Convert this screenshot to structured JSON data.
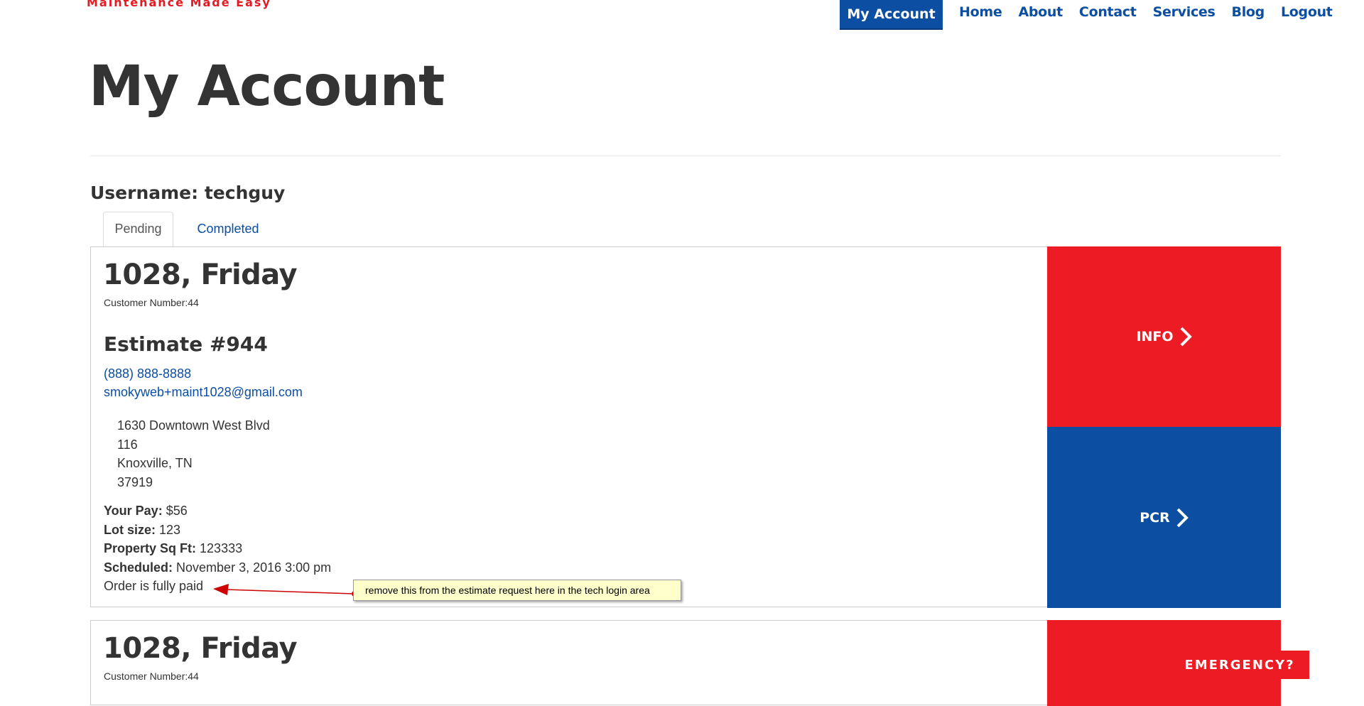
{
  "header": {
    "tagline": "Maintenance Made Easy",
    "nav": {
      "active": "My Account",
      "links": [
        "Home",
        "About",
        "Contact",
        "Services",
        "Blog",
        "Logout"
      ]
    }
  },
  "page": {
    "title": "My Account",
    "username": "Username: techguy"
  },
  "tabs": [
    "Pending",
    "Completed"
  ],
  "orders": [
    {
      "title": "1028, Friday",
      "customer_number": "Customer Number:44",
      "estimate": "Estimate #944",
      "phone": "(888) 888-8888",
      "email": "smokyweb+maint1028@gmail.com",
      "address": [
        "1630 Downtown West Blvd",
        "116",
        "Knoxville, TN",
        "37919"
      ],
      "details": [
        {
          "label": "Your Pay:",
          "value": "$56"
        },
        {
          "label": "Lot size:",
          "value": "123"
        },
        {
          "label": "Property Sq Ft:",
          "value": "123333"
        },
        {
          "label": "Scheduled:",
          "value": "November 3, 2016 3:00 pm"
        }
      ],
      "status": "Order is fully paid",
      "buttons": {
        "info": "INFO",
        "pcr": "PCR"
      }
    },
    {
      "title": "1028, Friday",
      "customer_number": "Customer Number:44"
    }
  ],
  "annotation": {
    "note": "remove this from the estimate request here in the tech login area"
  },
  "emergency": "EMERGENCY?",
  "colors": {
    "brand_red": "#ed1c24",
    "brand_blue": "#0b4ea2",
    "note_bg": "#ffffcc"
  }
}
